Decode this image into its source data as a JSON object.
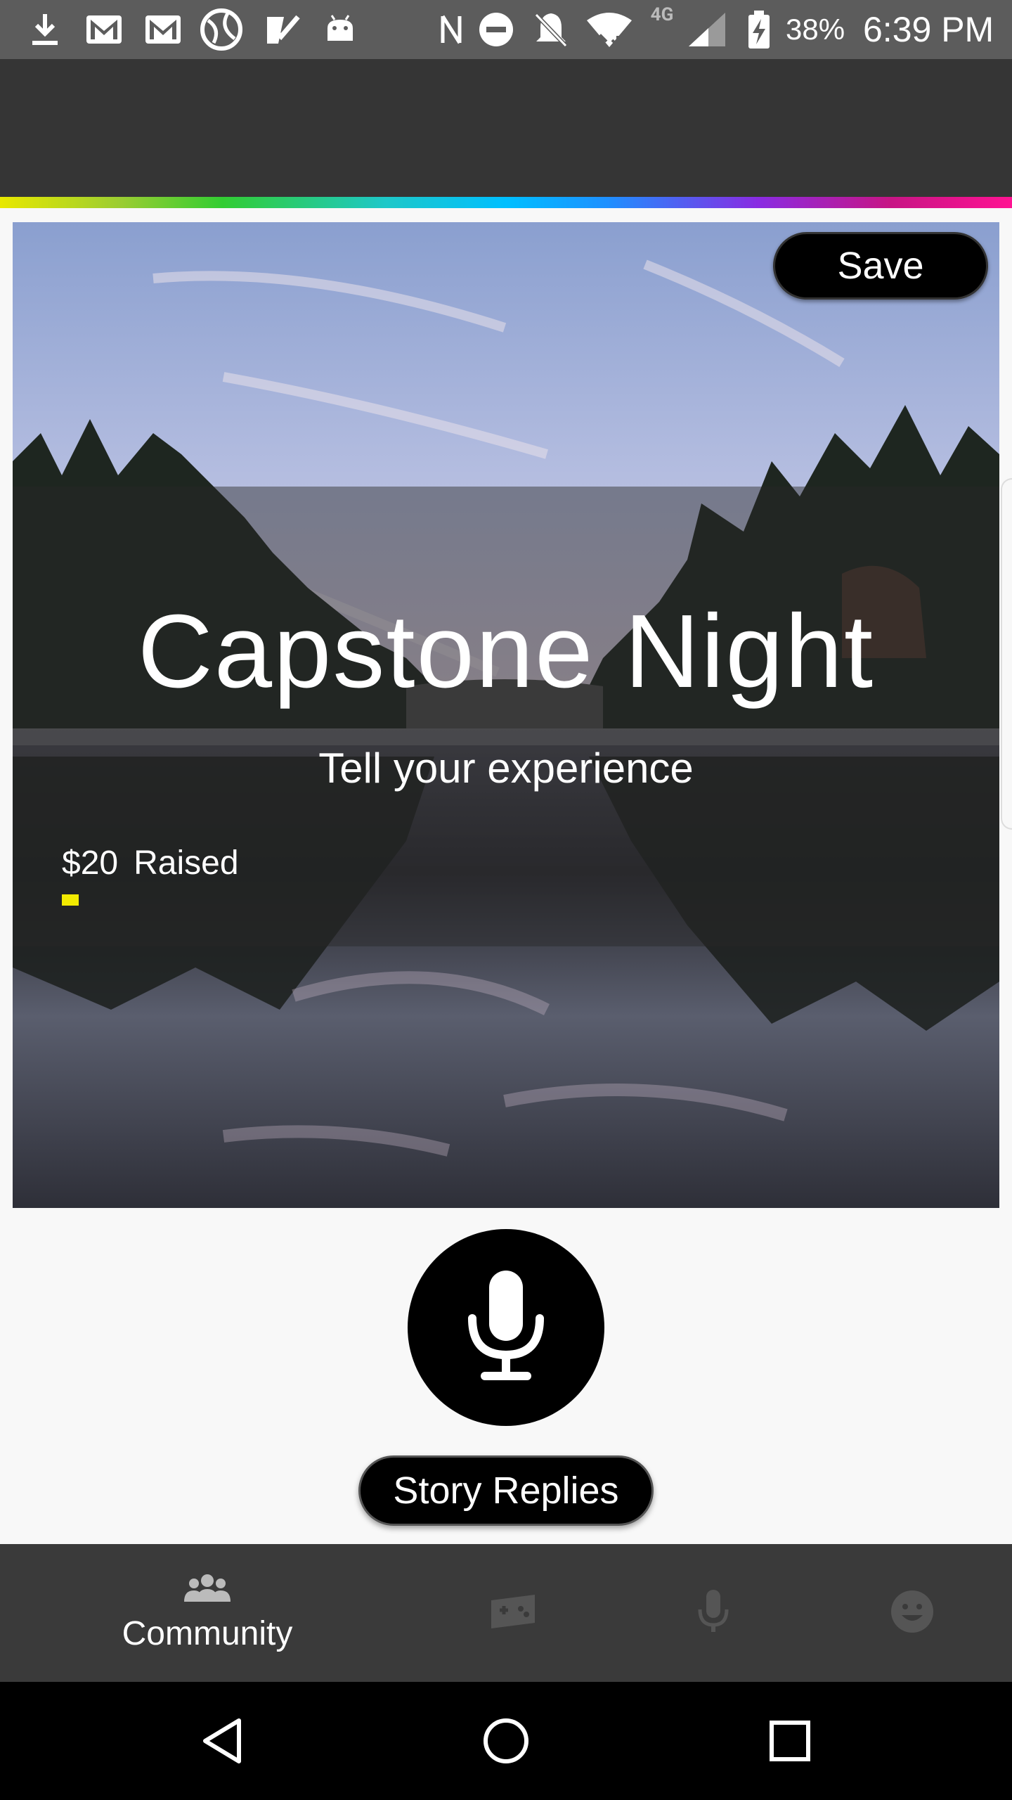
{
  "status_bar": {
    "battery_percent": "38%",
    "time": "6:39 PM",
    "network": "4G",
    "icons": [
      "download-icon",
      "gmail-icon",
      "gmail-icon",
      "globe-icon",
      "check-badge-icon",
      "android-icon",
      "nfc-icon",
      "do-not-disturb-icon",
      "notifications-off-icon",
      "wifi-icon",
      "signal-icon",
      "battery-charging-icon"
    ]
  },
  "event": {
    "title": "Capstone Night",
    "subtitle": "Tell your experience",
    "raised_amount": "$20",
    "raised_label": "Raised",
    "raised_progress": 0.02,
    "save_label": "Save"
  },
  "actions": {
    "record_icon": "microphone-icon",
    "story_replies_label": "Story Replies"
  },
  "bottom_nav": {
    "items": [
      {
        "label": "Community",
        "icon": "community-icon",
        "active": true
      },
      {
        "label": "",
        "icon": "games-icon",
        "active": false
      },
      {
        "label": "",
        "icon": "microphone-icon",
        "active": false
      },
      {
        "label": "",
        "icon": "smiley-icon",
        "active": false
      }
    ]
  },
  "system_nav": {
    "buttons": [
      "back-icon",
      "home-icon",
      "recents-icon"
    ]
  },
  "colors": {
    "accent_progress": "#f2ea00",
    "appbar": "#353535",
    "bottom_nav": "#3a3a3a",
    "status_bar": "#5c5c5c"
  }
}
